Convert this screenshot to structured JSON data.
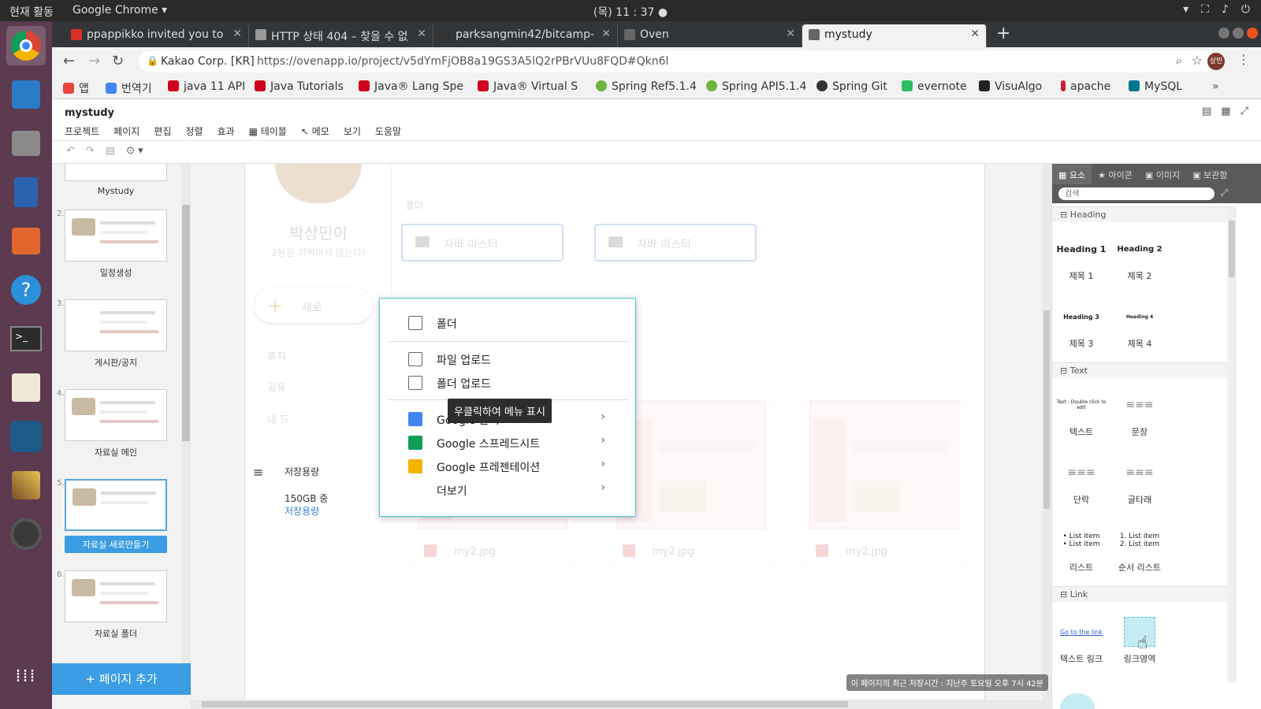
{
  "topbar": {
    "activities": "현재 활동",
    "app_name": "Google Chrome ▾",
    "clock": "(목) 11 : 37 ●"
  },
  "tabs": [
    {
      "label": "ppappikko invited you to",
      "icon_color": "#d93025"
    },
    {
      "label": "HTTP 상태 404 – 찾을 수 없",
      "icon_color": "#999999"
    },
    {
      "label": "parksangmin42/bitcamp-",
      "icon_color": "#333333"
    },
    {
      "label": "Oven",
      "icon_color": "#666666"
    },
    {
      "label": "mystudy",
      "icon_color": "#666666"
    }
  ],
  "omnibar": {
    "org": "Kakao Corp. [KR]",
    "url": "https://ovenapp.io/project/v5dYmFjOB8a19GS3A5lQ2rPBrVUu8FQD#Qkn6l",
    "avatar": "상민"
  },
  "bookmarks": [
    {
      "label": "앱",
      "icon": "apps-grid-icon",
      "color": "#e8453c"
    },
    {
      "label": "번역기",
      "icon": "google-icon",
      "color": "#4285f4"
    },
    {
      "label": "java 11 API",
      "icon": "oracle-icon",
      "color": "#d0021b"
    },
    {
      "label": "Java Tutorials",
      "icon": "oracle-icon",
      "color": "#d0021b"
    },
    {
      "label": "Java® Lang Spe",
      "icon": "oracle-icon",
      "color": "#d0021b"
    },
    {
      "label": "Java® Virtual S",
      "icon": "oracle-icon",
      "color": "#d0021b"
    },
    {
      "label": "Spring Ref5.1.4",
      "icon": "spring-icon",
      "color": "#6db33f"
    },
    {
      "label": "Spring API5.1.4",
      "icon": "spring-icon",
      "color": "#6db33f"
    },
    {
      "label": "Spring Git",
      "icon": "github-icon",
      "color": "#333333"
    },
    {
      "label": "evernote",
      "icon": "evernote-icon",
      "color": "#2dbe60"
    },
    {
      "label": "VisuAlgo",
      "icon": "visualgo-icon",
      "color": "#222222"
    },
    {
      "label": "apache",
      "icon": "apache-feather-icon",
      "color": "#c92037"
    },
    {
      "label": "MySQL",
      "icon": "mysql-icon",
      "color": "#00758f"
    }
  ],
  "app": {
    "title": "mystudy",
    "menu": [
      "프로젝트",
      "페이지",
      "편집",
      "정렬",
      "효과",
      "▦ 테이블",
      "↖ 메모",
      "보기",
      "도움말"
    ]
  },
  "pages": [
    {
      "num": "",
      "label": "Mystudy"
    },
    {
      "num": "2.",
      "label": "일정생성"
    },
    {
      "num": "3.",
      "label": "게시판/공지"
    },
    {
      "num": "4.",
      "label": "자료실 메인"
    },
    {
      "num": "5.",
      "label": "자료실 새로만들기"
    },
    {
      "num": "6.",
      "label": "자료실 폴더"
    }
  ],
  "add_page": "+ 페이지 추가",
  "canvas": {
    "profile_name": "박상민이",
    "profile_sub": "2등은 기억하지 않는다!",
    "new_button": "새로",
    "side_items": [
      "휴지",
      "공유",
      "내 드"
    ],
    "folder_label": "폴더",
    "folders": [
      "자바 마스터",
      "자바 마스터"
    ],
    "files": [
      "my2.jpg",
      "my2.jpg",
      "my2.jpg"
    ],
    "storage_title": "저장용량",
    "storage_amount": "150GB 중",
    "storage_link": "저장용량 "
  },
  "dropdown": {
    "folder": "폴더",
    "file_upload": "파일 업로드",
    "folder_upload": "폴더 업로드",
    "gdocs": "Google 문서",
    "gsheets": "Google 스프레드시트",
    "gslides": "Google 프레젠테이션",
    "more": "더보기"
  },
  "tooltip": "우클릭하여 메뉴 표시",
  "save_status": "이 페이지의 최근 저장시간 : 지난주 토요일 오후 7시 42분",
  "right_panel": {
    "tabs": [
      "▦ 요소",
      "★ 아이콘",
      "▣ 이미지",
      "▣ 보관함"
    ],
    "search_placeholder": "검색",
    "sections": [
      "Heading",
      "Text",
      "Link"
    ],
    "heading_items": [
      {
        "preview": "Heading 1",
        "label": "제목 1"
      },
      {
        "preview": "Heading 2",
        "label": "제목 2"
      },
      {
        "preview": "Heading 3",
        "label": "제목 3"
      },
      {
        "preview": "Heading 4",
        "label": "제목 4"
      }
    ],
    "text_items": [
      {
        "preview": "Text - Double click to edit",
        "label": "텍스트"
      },
      {
        "preview": "≡≡≡",
        "label": "문장"
      },
      {
        "preview": "≡≡≡",
        "label": "단락"
      },
      {
        "preview": "≡≡≡",
        "label": "글타래"
      },
      {
        "preview": "• List item\n• List item",
        "label": "리스트"
      },
      {
        "preview": "1. List item\n2. List item",
        "label": "순서 리스트"
      }
    ],
    "link_items": [
      {
        "preview": "Go to the link",
        "label": "텍스트 링크"
      },
      {
        "preview": "",
        "label": "링크영역"
      }
    ]
  }
}
